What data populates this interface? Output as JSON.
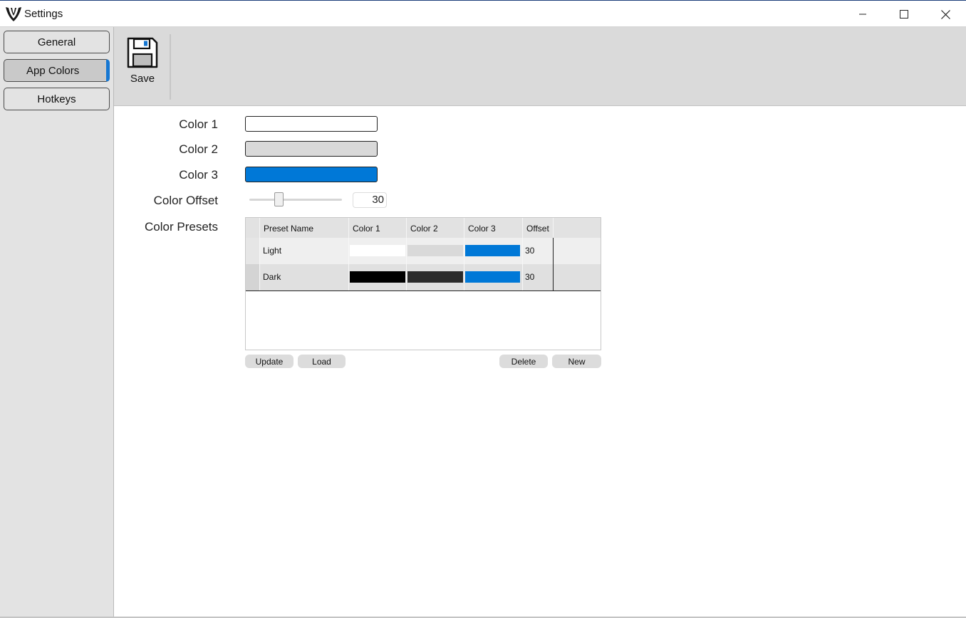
{
  "window": {
    "title": "Settings",
    "controls": [
      "minimize",
      "maximize",
      "close"
    ]
  },
  "sidebar": {
    "items": [
      {
        "label": "General",
        "selected": false
      },
      {
        "label": "App Colors",
        "selected": true
      },
      {
        "label": "Hotkeys",
        "selected": false
      }
    ]
  },
  "toolbar": {
    "save_label": "Save",
    "save_icon": "floppy-disk-icon"
  },
  "colors": {
    "color1": {
      "label": "Color 1",
      "value": "#ffffff"
    },
    "color2": {
      "label": "Color 2",
      "value": "#d9d9d9"
    },
    "color3": {
      "label": "Color 3",
      "value": "#0078d7"
    },
    "accent": "#1677d2"
  },
  "offset": {
    "label": "Color Offset",
    "value": "30",
    "slider_fraction": 0.3
  },
  "presets": {
    "label": "Color Presets",
    "columns": [
      "Preset Name",
      "Color 1",
      "Color 2",
      "Color 3",
      "Offset"
    ],
    "rows": [
      {
        "name": "Light",
        "color1": "#ffffff",
        "color2": "#d9d9d9",
        "color3": "#0078d7",
        "offset": "30"
      },
      {
        "name": "Dark",
        "color1": "#000000",
        "color2": "#2b2b2b",
        "color3": "#0078d7",
        "offset": "30"
      }
    ]
  },
  "buttons": {
    "update": "Update",
    "load": "Load",
    "delete": "Delete",
    "new": "New"
  }
}
